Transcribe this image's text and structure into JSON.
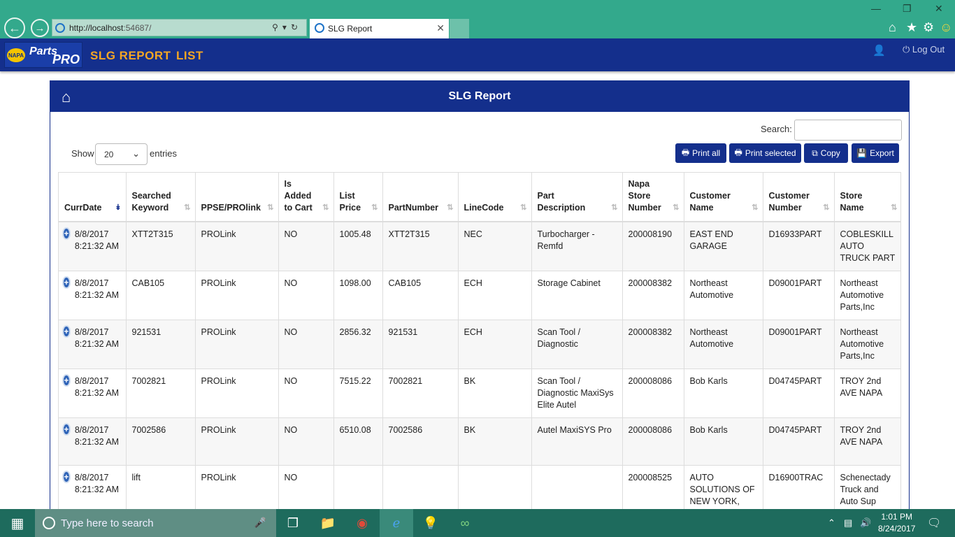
{
  "browser": {
    "url": "http://localhost:54687/",
    "url_host": "http://localhost",
    "url_rest": ":54687/",
    "tab_title": "SLG Report"
  },
  "app": {
    "logo_text": "Parts",
    "logo_pro": "PRO",
    "logo_napa": "NAPA",
    "nav": [
      "SLG REPORT",
      "LIST"
    ],
    "logout_label": "Log Out"
  },
  "panel": {
    "title": "SLG Report",
    "search_label": "Search:",
    "show_label": "Show",
    "entries_value": "20",
    "entries_label": "entries",
    "buttons": [
      "Print all",
      "Print selected",
      "Copy",
      "Export"
    ]
  },
  "table": {
    "columns": [
      [
        "CurrDate"
      ],
      [
        "Searched",
        "Keyword"
      ],
      [
        "PPSE/PROlink"
      ],
      [
        "Is",
        "Added",
        "to Cart"
      ],
      [
        "List",
        "Price"
      ],
      [
        "PartNumber"
      ],
      [
        "LineCode"
      ],
      [
        "Part",
        "Description"
      ],
      [
        "Napa",
        "Store",
        "Number"
      ],
      [
        "Customer",
        "Name"
      ],
      [
        "Customer",
        "Number"
      ],
      [
        "Store",
        "Name"
      ]
    ],
    "rows": [
      [
        "8/8/2017 8:21:32 AM",
        "XTT2T315",
        "PROLink",
        "NO",
        "1005.48",
        "XTT2T315",
        "NEC",
        "Turbocharger - Remfd",
        "200008190",
        "EAST END GARAGE",
        "D16933PART",
        "COBLESKILL AUTO TRUCK PART"
      ],
      [
        "8/8/2017 8:21:32 AM",
        "CAB105",
        "PROLink",
        "NO",
        "1098.00",
        "CAB105",
        "ECH",
        "Storage Cabinet",
        "200008382",
        "Northeast Automotive",
        "D09001PART",
        "Northeast Automotive Parts,Inc"
      ],
      [
        "8/8/2017 8:21:32 AM",
        "921531",
        "PROLink",
        "NO",
        "2856.32",
        "921531",
        "ECH",
        "Scan Tool / Diagnostic",
        "200008382",
        "Northeast Automotive",
        "D09001PART",
        "Northeast Automotive Parts,Inc"
      ],
      [
        "8/8/2017 8:21:32 AM",
        "7002821",
        "PROLink",
        "NO",
        "7515.22",
        "7002821",
        "BK",
        "Scan Tool / Diagnostic MaxiSys Elite Autel",
        "200008086",
        "Bob Karls",
        "D04745PART",
        "TROY 2nd AVE NAPA"
      ],
      [
        "8/8/2017 8:21:32 AM",
        "7002586",
        "PROLink",
        "NO",
        "6510.08",
        "7002586",
        "BK",
        "Autel MaxiSYS Pro",
        "200008086",
        "Bob Karls",
        "D04745PART",
        "TROY 2nd AVE NAPA"
      ],
      [
        "8/8/2017 8:21:32 AM",
        "lift",
        "PROLink",
        "NO",
        "",
        "",
        "",
        "",
        "200008525",
        "AUTO SOLUTIONS OF NEW YORK, INC",
        "D16900TRAC",
        "Schenectady Truck and Auto Sup"
      ]
    ]
  },
  "taskbar": {
    "search_placeholder": "Type here to search",
    "time": "1:01 PM",
    "date": "8/24/2017"
  }
}
